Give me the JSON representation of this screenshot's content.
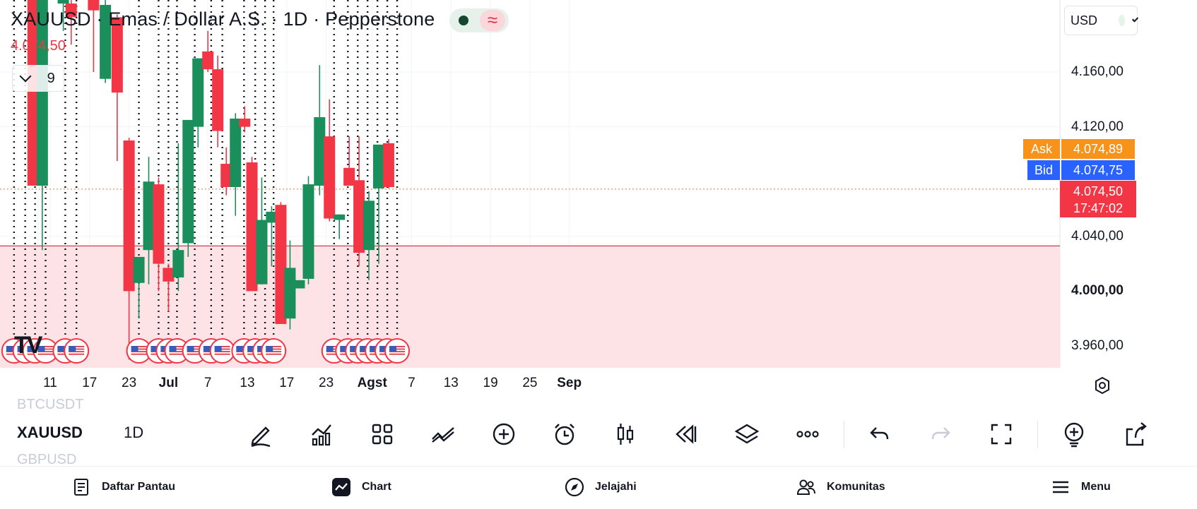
{
  "header": {
    "title": "XAUUSD · Emas / Dollar A.S. · 1D · Pepperstone",
    "last_price": "4.074,50",
    "indicator_count": "9"
  },
  "currency_selector": {
    "label": "USD"
  },
  "colors": {
    "up": "#1a8f5c",
    "down": "#f23645",
    "zone": "#fde3e6",
    "ask": "#f7931a",
    "bid": "#2962ff",
    "price_line": "#f23645"
  },
  "price_tags": {
    "ask_label": "Ask",
    "ask_value": "4.074,89",
    "bid_label": "Bid",
    "bid_value": "4.074,75",
    "last_value": "4.074,50",
    "countdown": "17:47:02"
  },
  "chart_data": {
    "type": "candlestick",
    "symbol": "XAUUSD",
    "interval": "1D",
    "y_ticks": [
      {
        "value": 4160,
        "label": "4.160,00",
        "bold": false
      },
      {
        "value": 4120,
        "label": "4.120,00",
        "bold": false
      },
      {
        "value": 4040,
        "label": "4.040,00",
        "bold": false
      },
      {
        "value": 4000,
        "label": "4.000,00",
        "bold": true
      },
      {
        "value": 3960,
        "label": "3.960,00",
        "bold": false
      }
    ],
    "x_ticks": [
      {
        "day": 11,
        "label": "11",
        "bold": false
      },
      {
        "day": 17,
        "label": "17",
        "bold": false
      },
      {
        "day": 23,
        "label": "23",
        "bold": false
      },
      {
        "day": 29,
        "label": "Jul",
        "bold": true
      },
      {
        "day": 35,
        "label": "7",
        "bold": false
      },
      {
        "day": 41,
        "label": "13",
        "bold": false
      },
      {
        "day": 47,
        "label": "17",
        "bold": false
      },
      {
        "day": 53,
        "label": "23",
        "bold": false
      },
      {
        "day": 60,
        "label": "Agst",
        "bold": true
      },
      {
        "day": 66,
        "label": "7",
        "bold": false
      },
      {
        "day": 72,
        "label": "13",
        "bold": false
      },
      {
        "day": 78,
        "label": "19",
        "bold": false
      },
      {
        "day": 84,
        "label": "25",
        "bold": false
      },
      {
        "day": 90,
        "label": "Sep",
        "bold": true
      }
    ],
    "zone": {
      "top": 4033,
      "bottom": 3944
    },
    "last_price": 4074.5,
    "candles": [
      {
        "d": 8.4,
        "o": 4275,
        "h": 4290,
        "l": 4077,
        "c": 4077
      },
      {
        "d": 9.8,
        "o": 4077,
        "h": 4280,
        "l": 4030,
        "c": 4265
      },
      {
        "d": 13.0,
        "o": 4210,
        "h": 4225,
        "l": 4190,
        "c": 4218
      },
      {
        "d": 14.2,
        "o": 4210,
        "h": 4222,
        "l": 4180,
        "c": 4200
      },
      {
        "d": 17.6,
        "o": 4240,
        "h": 4250,
        "l": 4160,
        "c": 4205
      },
      {
        "d": 19.4,
        "o": 4155,
        "h": 4230,
        "l": 4152,
        "c": 4209
      },
      {
        "d": 21.2,
        "o": 4200,
        "h": 4202,
        "l": 4095,
        "c": 4145
      },
      {
        "d": 23.0,
        "o": 4110,
        "h": 4112,
        "l": 3950,
        "c": 4000
      },
      {
        "d": 24.5,
        "o": 4006,
        "h": 4012,
        "l": 3980,
        "c": 4025
      },
      {
        "d": 26.0,
        "o": 4030,
        "h": 4098,
        "l": 4005,
        "c": 4080
      },
      {
        "d": 27.5,
        "o": 4078,
        "h": 4083,
        "l": 4000,
        "c": 4020
      },
      {
        "d": 29.0,
        "o": 4017,
        "h": 4020,
        "l": 3985,
        "c": 4007
      },
      {
        "d": 30.5,
        "o": 4010,
        "h": 4108,
        "l": 4000,
        "c": 4030
      },
      {
        "d": 32.0,
        "o": 4035,
        "h": 4125,
        "l": 4025,
        "c": 4125
      },
      {
        "d": 33.5,
        "o": 4120,
        "h": 4170,
        "l": 4105,
        "c": 4170
      },
      {
        "d": 35.0,
        "o": 4175,
        "h": 4190,
        "l": 4160,
        "c": 4162
      },
      {
        "d": 36.5,
        "o": 4162,
        "h": 4172,
        "l": 4105,
        "c": 4117
      },
      {
        "d": 37.8,
        "o": 4093,
        "h": 4105,
        "l": 4070,
        "c": 4076
      },
      {
        "d": 39.2,
        "o": 4076,
        "h": 4130,
        "l": 4055,
        "c": 4126
      },
      {
        "d": 40.6,
        "o": 4126,
        "h": 4135,
        "l": 4116,
        "c": 4120
      },
      {
        "d": 41.7,
        "o": 4094,
        "h": 4098,
        "l": 4003,
        "c": 4000
      },
      {
        "d": 43.2,
        "o": 4005,
        "h": 4083,
        "l": 4005,
        "c": 4052
      },
      {
        "d": 44.7,
        "o": 4050,
        "h": 4062,
        "l": 4018,
        "c": 4058
      },
      {
        "d": 46.1,
        "o": 4063,
        "h": 4065,
        "l": 3983,
        "c": 3976
      },
      {
        "d": 47.5,
        "o": 3980,
        "h": 4037,
        "l": 3972,
        "c": 4017
      },
      {
        "d": 48.9,
        "o": 4002,
        "h": 4008,
        "l": 4003,
        "c": 4008
      },
      {
        "d": 50.3,
        "o": 4009,
        "h": 4084,
        "l": 4005,
        "c": 4078
      },
      {
        "d": 52.0,
        "o": 4077,
        "h": 4165,
        "l": 4070,
        "c": 4127
      },
      {
        "d": 53.5,
        "o": 4113,
        "h": 4140,
        "l": 4051,
        "c": 4053
      },
      {
        "d": 55.0,
        "o": 4052,
        "h": 4056,
        "l": 4038,
        "c": 4056
      },
      {
        "d": 56.5,
        "o": 4090,
        "h": 4113,
        "l": 4079,
        "c": 4077
      },
      {
        "d": 58.0,
        "o": 4081,
        "h": 4113,
        "l": 4018,
        "c": 4028
      },
      {
        "d": 59.5,
        "o": 4030,
        "h": 4073,
        "l": 4008,
        "c": 4066
      },
      {
        "d": 61.0,
        "o": 4075,
        "h": 4097,
        "l": 4020,
        "c": 4107
      },
      {
        "d": 62.5,
        "o": 4108,
        "h": 4111,
        "l": 4075,
        "c": 4076
      }
    ],
    "event_markers": [
      0,
      1,
      2,
      3,
      7,
      8,
      12,
      13,
      14,
      16,
      18,
      19,
      21,
      22,
      23,
      25,
      26,
      32,
      33,
      34,
      35,
      36,
      37,
      39,
      41,
      42,
      43,
      44,
      45,
      46,
      47,
      48
    ],
    "event_days": [
      5.5,
      7.2,
      8.7,
      10.3,
      13.3,
      15.0,
      24.5,
      27.5,
      29.0,
      30.3,
      33.0,
      35.5,
      37.2,
      40.5,
      42.2,
      43.7,
      45.0,
      54.2,
      56.3,
      57.8,
      59.3,
      60.8,
      62.3,
      63.8
    ]
  },
  "watchlist_ghost": {
    "above": "BTCUSDT",
    "below": "GBPUSD"
  },
  "toolbar": {
    "symbol": "XAUUSD",
    "interval": "1D",
    "icons": [
      "pencil-icon",
      "indicators-icon",
      "templates-icon",
      "compare-icon",
      "add-icon",
      "alert-icon",
      "candles-icon",
      "replay-icon",
      "layers-icon",
      "more-icon",
      "undo-icon",
      "redo-icon",
      "fullscreen-icon",
      "idea-icon",
      "share-icon"
    ]
  },
  "nav": {
    "watchlist": "Daftar Pantau",
    "chart": "Chart",
    "explore": "Jelajahi",
    "community": "Komunitas",
    "menu": "Menu"
  }
}
